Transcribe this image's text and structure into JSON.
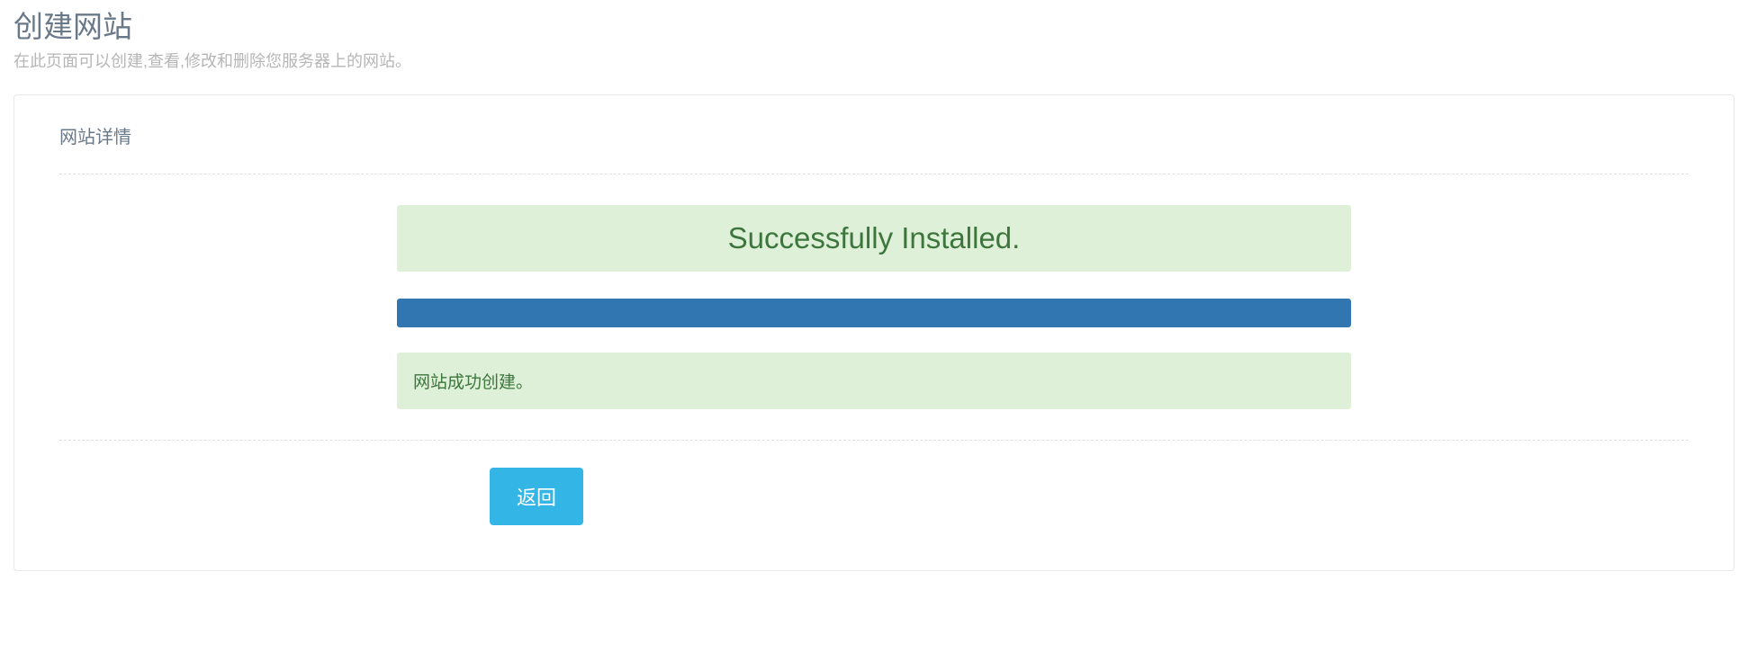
{
  "header": {
    "title": "创建网站",
    "subtitle": "在此页面可以创建,查看,修改和删除您服务器上的网站。"
  },
  "panel": {
    "section_title": "网站详情",
    "install_status": "Successfully Installed.",
    "progress_percent": 100,
    "result_message": "网站成功创建。",
    "back_button": "返回"
  }
}
